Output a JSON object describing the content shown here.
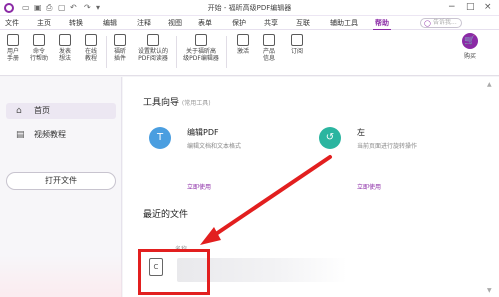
{
  "titlebar": {
    "title": "开始 - 福昕高级PDF编辑器",
    "window_controls": [
      "minimize-icon",
      "maximize-icon",
      "close-icon"
    ]
  },
  "menu": {
    "items": [
      "文件",
      "主页",
      "转换",
      "编辑",
      "注释",
      "视图",
      "表单",
      "保护",
      "共享",
      "互联",
      "辅助工具",
      "帮助"
    ],
    "active": "帮助",
    "search_placeholder": "告诉我..."
  },
  "toolbar": {
    "tools": [
      {
        "label": "用户\n手册",
        "icon": "manual-icon"
      },
      {
        "label": "命令\n行帮助",
        "icon": "command-help-icon"
      },
      {
        "label": "发表\n想法",
        "icon": "feedback-icon"
      },
      {
        "label": "在线\n教程",
        "icon": "tutorial-icon"
      },
      {
        "label": "福昕\n插件",
        "icon": "plugin-icon"
      },
      {
        "label": "设置默认的\nPDF阅读器",
        "icon": "default-reader-icon"
      },
      {
        "label": "关于福昕高\n级PDF编辑器",
        "icon": "about-icon"
      },
      {
        "label": "激活",
        "icon": "activate-icon"
      },
      {
        "label": "产品\n信息",
        "icon": "product-info-icon"
      },
      {
        "label": "订阅",
        "icon": "subscribe-icon"
      }
    ],
    "buy_label": "购买",
    "buy_icon": "cart-icon"
  },
  "sidebar": {
    "items": [
      {
        "label": "首页",
        "icon": "home-icon",
        "active": true
      },
      {
        "label": "视频教程",
        "icon": "video-icon",
        "active": false
      }
    ],
    "open_file": "打开文件"
  },
  "main": {
    "tools_title": "工具向导",
    "tools_sub": "(常用工具)",
    "cards": [
      {
        "name": "编辑PDF",
        "desc": "编辑文档和文本格式",
        "link": "立即使用",
        "icon": "edit-pdf-icon",
        "color": "#4a9ee0"
      },
      {
        "name": "左",
        "desc": "当前页面进行旋转操作",
        "link": "立即使用",
        "icon": "rotate-icon",
        "color": "#2bb5a0"
      }
    ],
    "recent_title": "最近的文件",
    "col_name": "名称"
  },
  "colors": {
    "accent": "#8b2aa6",
    "highlight": "#e21f1f"
  }
}
